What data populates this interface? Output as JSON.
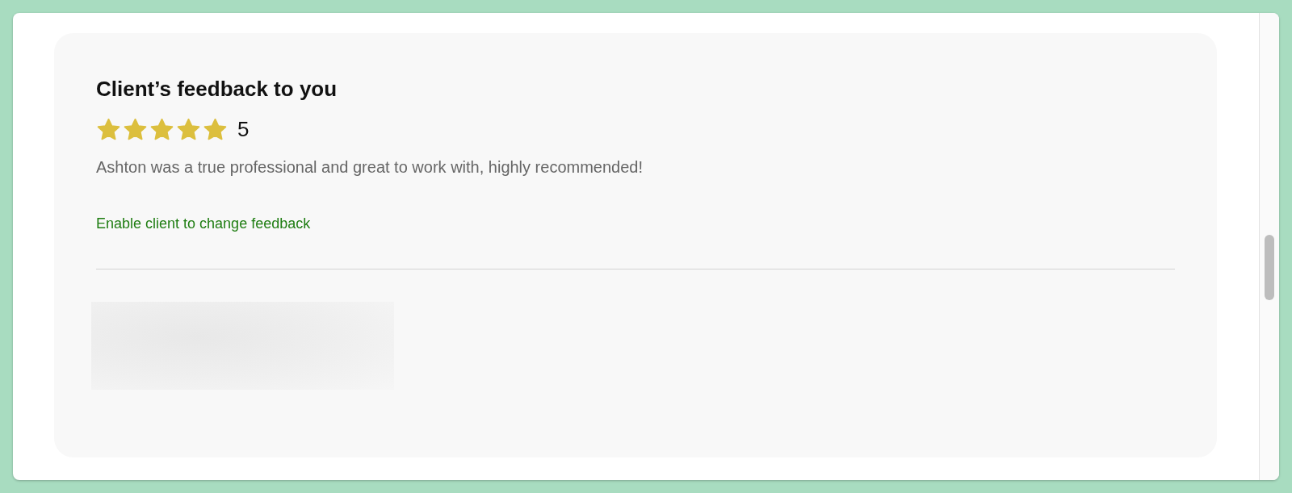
{
  "feedback": {
    "title": "Client’s feedback to you",
    "rating": {
      "stars": 5,
      "value": "5"
    },
    "comment": "Ashton was a true professional and great to work with, highly recommended!",
    "link": "Enable client to change feedback"
  }
}
